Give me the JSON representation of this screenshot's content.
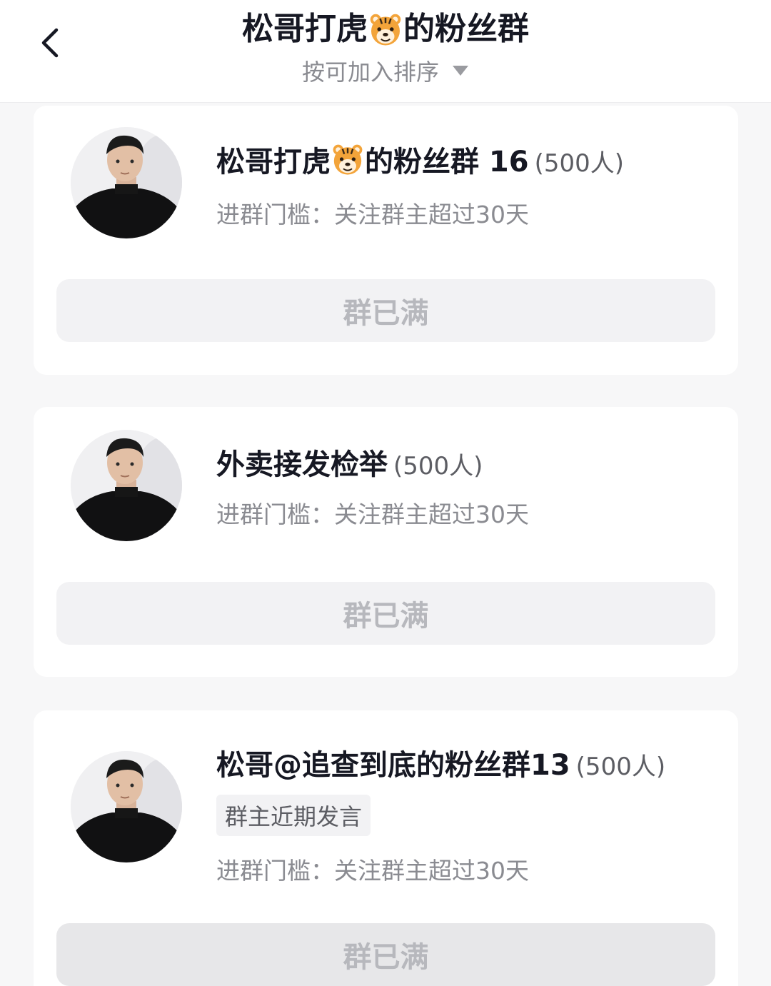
{
  "header": {
    "title_prefix": "松哥打虎",
    "title_suffix": "的粉丝群",
    "sort_label": "按可加入排序"
  },
  "groups": [
    {
      "name_prefix": "松哥打虎",
      "name_suffix": "的粉丝群 16",
      "count": "(500人)",
      "threshold": "进群门槛：关注群主超过30天",
      "button": "群已满"
    },
    {
      "name": "外卖接发检举",
      "count": "(500人)",
      "threshold": "进群门槛：关注群主超过30天",
      "button": "群已满"
    },
    {
      "name": "松哥@追查到底的粉丝群13",
      "count": "(500人)",
      "badge": "群主近期发言",
      "threshold": "进群门槛：关注群主超过30天",
      "button": "群已满"
    }
  ],
  "icons": {
    "back": "chevron-left-icon",
    "sort": "triangle-down-icon",
    "emoji": "tiger-face-icon",
    "avatar": "person-avatar"
  },
  "colors": {
    "background": "#f7f7f8",
    "card": "#ffffff",
    "primary_text": "#161823",
    "secondary_text": "#8a8b91",
    "button_bg": "#f2f2f4",
    "button_text": "#b7b8bd"
  }
}
